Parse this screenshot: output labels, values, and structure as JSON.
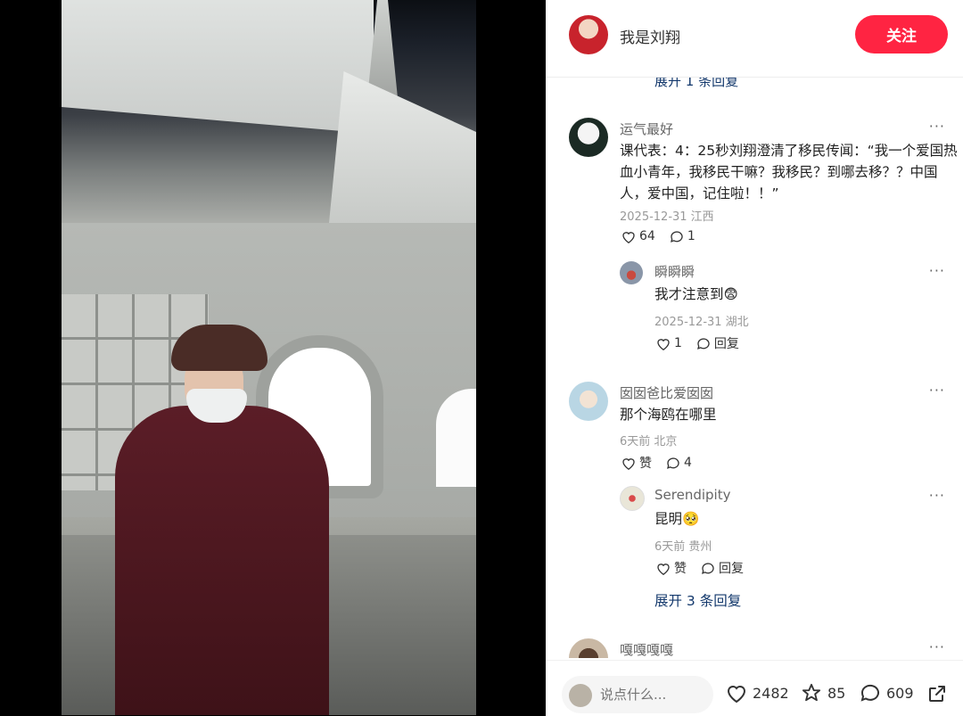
{
  "header": {
    "author": "我是刘翔",
    "follow_label": "关注"
  },
  "comments_top_expand": "展开 1 条回复",
  "comments": [
    {
      "user": "运气最好",
      "text_lines": [
        "课代表：4：25秒刘翔澄清了移民传闻：“我一个爱国热",
        "血小青年，我移民干嘛？我移民？到哪去移？？中国",
        "人，爱中国，记住啦！！”"
      ],
      "meta": "2025-12-31 江西",
      "likes": "64",
      "replies": "1",
      "reply": {
        "user": "瞬瞬瞬",
        "text": "我才注意到",
        "emoji": "😨",
        "meta": "2025-12-31 湖北",
        "likes": "1",
        "reply_label": "回复"
      }
    },
    {
      "user": "囡囡爸比爱囡囡",
      "text": "那个海鸥在哪里",
      "meta": "6天前 北京",
      "likes": "赞",
      "replies": "4",
      "reply": {
        "user": "Serendipity",
        "text": "昆明",
        "emoji": "🥺",
        "meta": "6天前 贵州",
        "likes": "赞",
        "reply_label": "回复"
      },
      "expand": "展开 3 条回复"
    },
    {
      "user": "嘎嘎嘎嘎"
    }
  ],
  "bottom": {
    "placeholder": "说点什么...",
    "likes": "2482",
    "stars": "85",
    "comments": "609"
  },
  "colors": {
    "accent": "#ff2442",
    "link": "#13386c"
  }
}
